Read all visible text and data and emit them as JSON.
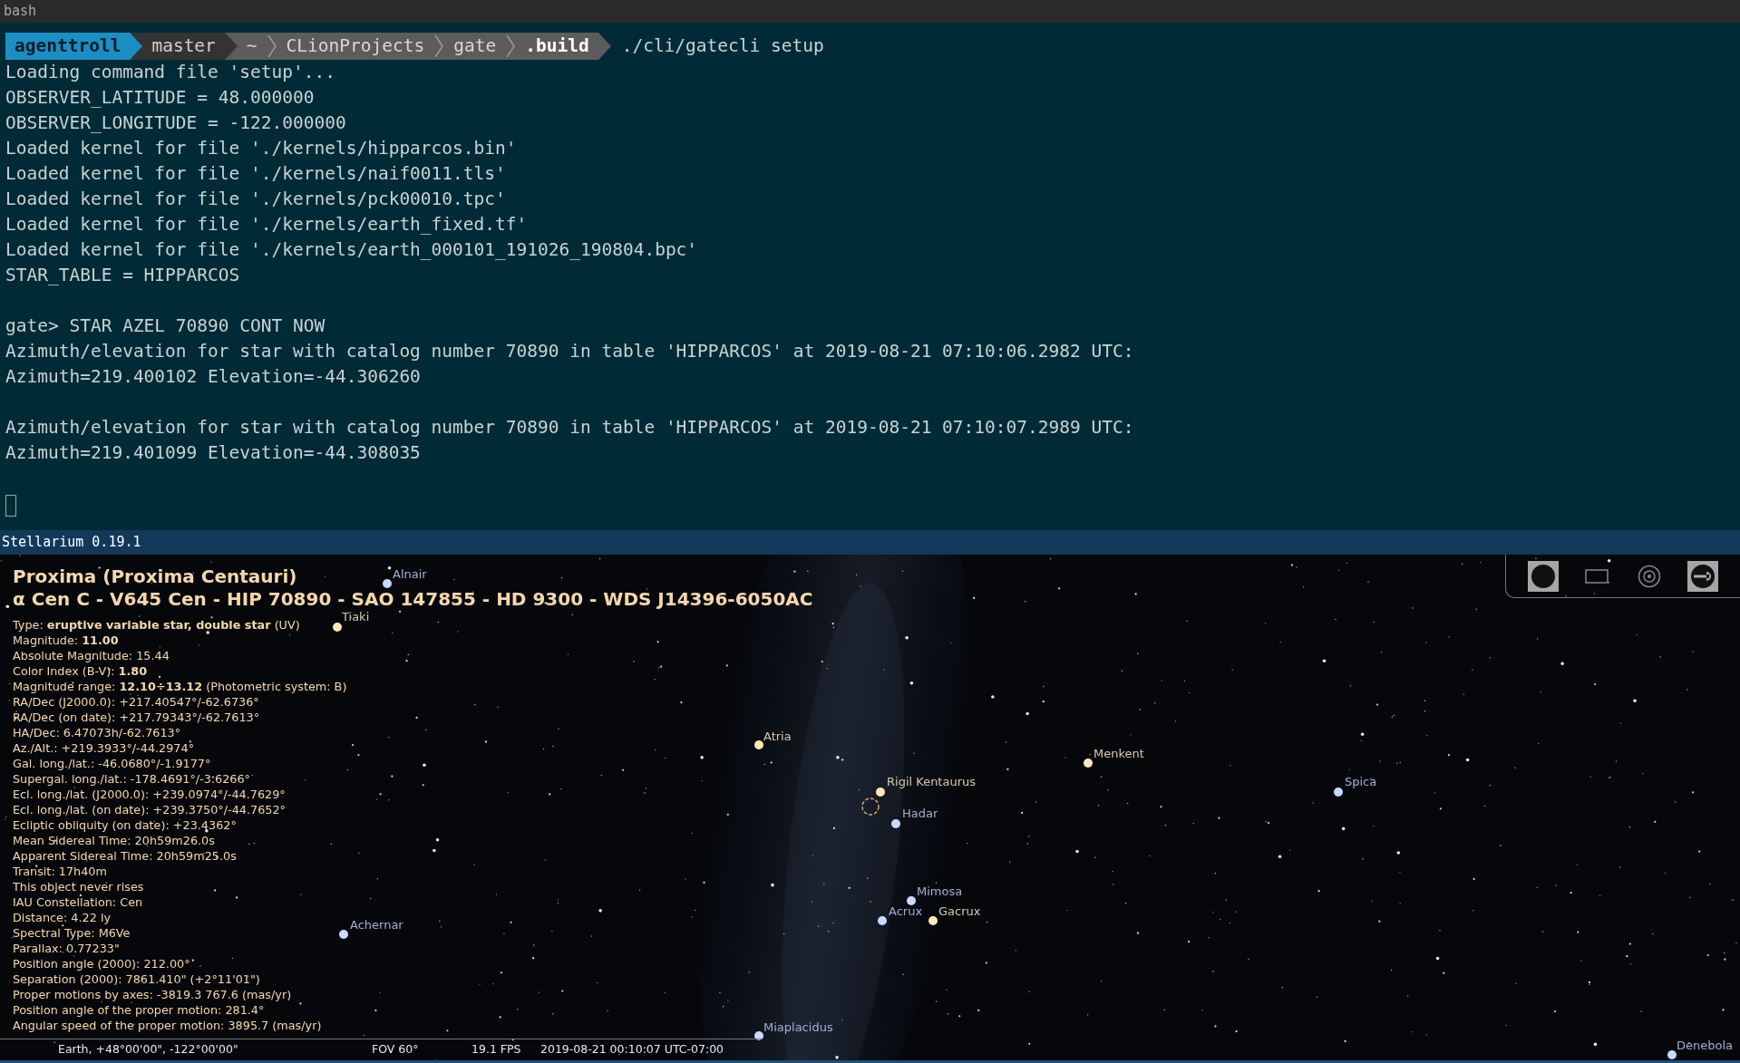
{
  "terminal": {
    "title": "bash",
    "prompt": {
      "segments": [
        {
          "kind": "user",
          "text": "agenttroll"
        },
        {
          "kind": "branch",
          "text": "master"
        },
        {
          "kind": "path",
          "text": "~"
        },
        {
          "kind": "path",
          "text": "CLionProjects"
        },
        {
          "kind": "path",
          "text": "gate"
        },
        {
          "kind": "current",
          "text": ".build"
        }
      ],
      "command": "./cli/gatecli setup"
    },
    "blocks": [
      [
        "Loading command file 'setup'...",
        "OBSERVER_LATITUDE = 48.000000",
        "OBSERVER_LONGITUDE = -122.000000",
        "Loaded kernel for file './kernels/hipparcos.bin'",
        "Loaded kernel for file './kernels/naif0011.tls'",
        "Loaded kernel for file './kernels/pck00010.tpc'",
        "Loaded kernel for file './kernels/earth_fixed.tf'",
        "Loaded kernel for file './kernels/earth_000101_191026_190804.bpc'",
        "STAR_TABLE = HIPPARCOS"
      ],
      [
        "gate> STAR AZEL 70890 CONT NOW",
        "Azimuth/elevation for star with catalog number 70890 in table 'HIPPARCOS' at 2019-08-21 07:10:06.2982 UTC:",
        "Azimuth=219.400102 Elevation=-44.306260"
      ],
      [
        "Azimuth/elevation for star with catalog number 70890 in table 'HIPPARCOS' at 2019-08-21 07:10:07.2989 UTC:",
        "Azimuth=219.401099 Elevation=-44.308035"
      ]
    ]
  },
  "stellarium": {
    "title": "Stellarium 0.19.1",
    "info": {
      "title_lines": [
        "Proxima (Proxima Centauri)",
        "α Cen C - V645 Cen - HIP 70890 - SAO 147855 - HD 9300 - WDS J14396-6050AC"
      ],
      "details": [
        "Type: **eruptive variable star, double star** (UV)",
        "Magnitude: **11.00**",
        "Absolute Magnitude: 15.44",
        "Color Index (B-V): **1.80**",
        "Magnitude range: **12.10÷13.12** (Photometric system: B)",
        "RA/Dec (J2000.0): +217.40547°/-62.6736°",
        "RA/Dec (on date): +217.79343°/-62.7613°",
        "HA/Dec: 6.47073h/-62.7613°",
        "Az./Alt.: +219.3933°/-44.2974°",
        "Gal. long./lat.: -46.0680°/-1.9177°",
        "Supergal. long./lat.: -178.4691°/-3.6266°",
        "Ecl. long./lat. (J2000.0): +239.0974°/-44.7629°",
        "Ecl. long./lat. (on date): +239.3750°/-44.7652°",
        "Ecliptic obliquity (on date): +23.4362°",
        "Mean Sidereal Time: 20h59m26.0s",
        "Apparent Sidereal Time: 20h59m25.0s",
        "Transit: 17h40m",
        "This object never rises",
        "IAU Constellation: Cen",
        "Distance: 4.22 ly",
        "Spectral Type: M6Ve",
        "Parallax: 0.77233\"",
        "Position angle (2000): 212.00°",
        "Separation (2000): 7861.410\" (+2°11'01\")",
        "Proper motions by axes: -3819.3 767.6 (mas/yr)",
        "Position angle of the proper motion: 281.4°",
        "Angular speed of the proper motion: 3895.7 (mas/yr)"
      ]
    },
    "star_labels": [
      "Alnair",
      "Tiaki",
      "Atria",
      "Menkent",
      "Rigil Kentaurus",
      "Hadar",
      "Spica",
      "Mimosa",
      "Acrux",
      "Gacrux",
      "Achernar",
      "Miaplacidus",
      "Denebola"
    ],
    "toolbar": [
      {
        "kind": "disc",
        "selected": true
      },
      {
        "kind": "rect",
        "selected": false
      },
      {
        "kind": "target",
        "selected": false
      },
      {
        "kind": "wrench",
        "selected": true
      }
    ],
    "status_bar": {
      "location": "Earth, +48°00'00\", -122°00'00\"",
      "fov": "FOV 60°",
      "fps": "19.1 FPS",
      "datetime": "2019-08-21 00:10:07 UTC-07:00"
    }
  }
}
